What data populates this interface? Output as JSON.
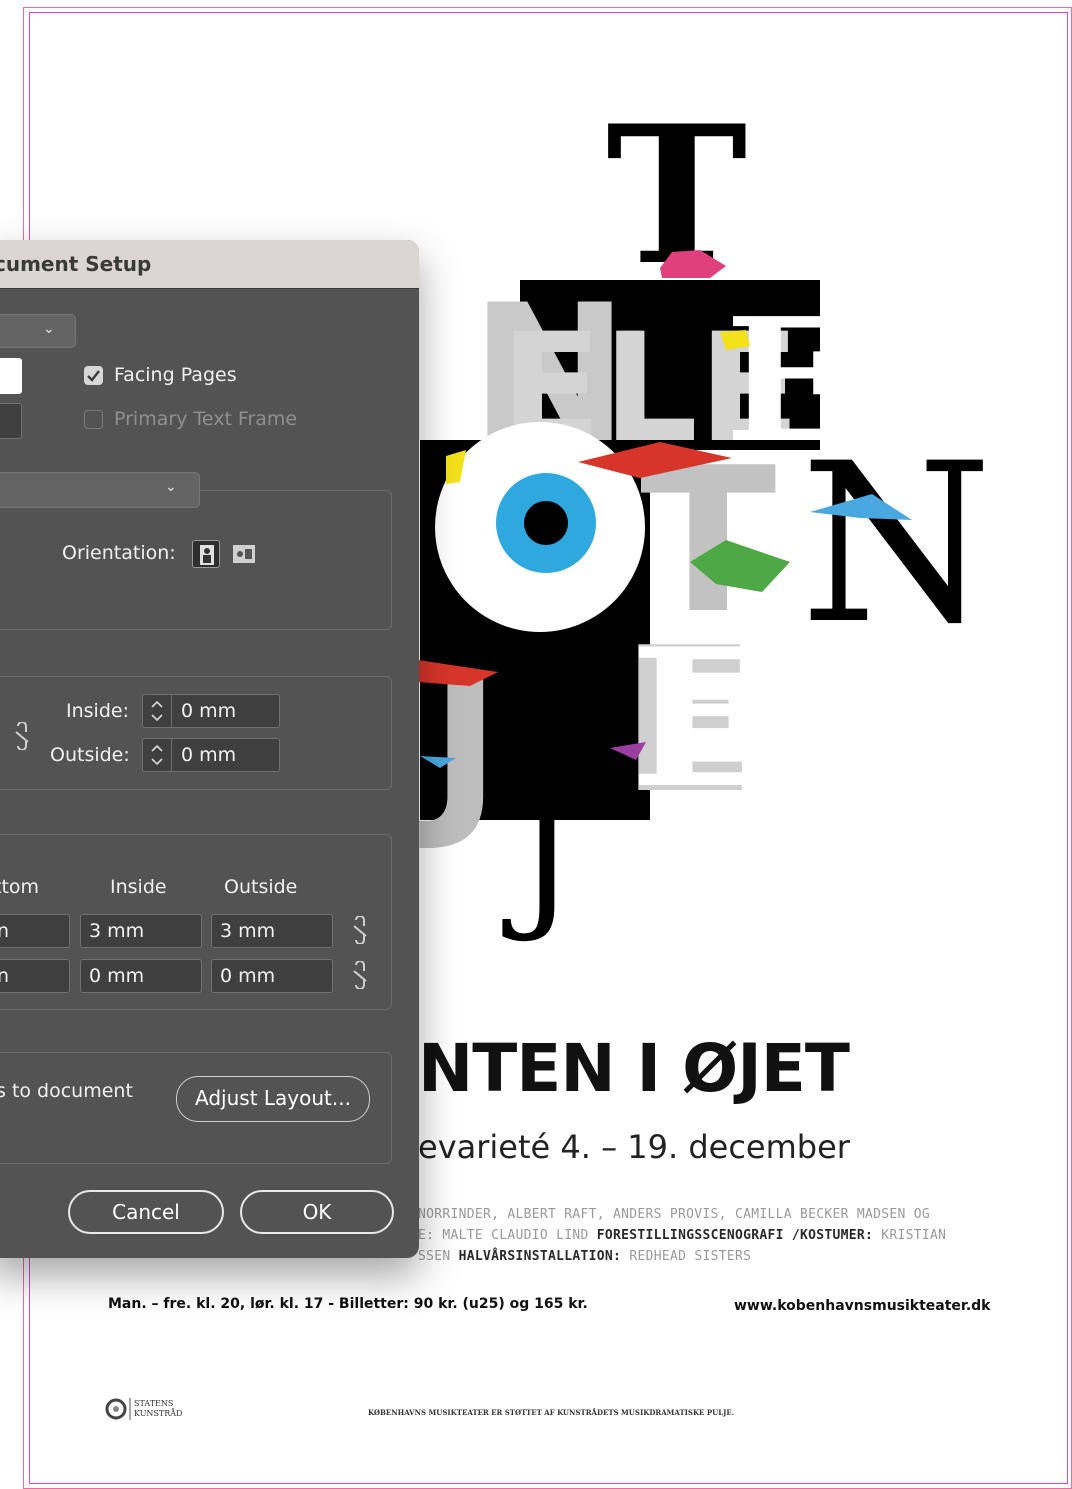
{
  "poster": {
    "title": "NTEN I ØJET",
    "subtitle": "evarieté 4. – 19. december",
    "credits_line1": "NORRINDER, ALBERT RAFT, ANDERS PROVIS, CAMILLA BECKER MADSEN OG",
    "credits_line2_a": "E: MALTE CLAUDIO LIND ",
    "credits_line2_b": "FORESTILLINGSSCENOGRAFI /KOSTUMER: ",
    "credits_line2_c": "KRISTIAN",
    "credits_line3_a": "SSEN ",
    "credits_line3_b": "HALVÅRSINSTALLATION: ",
    "credits_line3_c": "REDHEAD SISTERS",
    "info_left": "Man. – fre. kl. 20, lør. kl. 17 - Billetter: 90 kr. (u25) og 165 kr.",
    "info_right": "www.kobenhavnsmusikteater.dk",
    "sponsor_logo_text": "STATENS KUNSTRÅD",
    "sponsor_text": "KØBENHAVNS MUSIKTEATER ER STØTTET AF KUNSTRÅDETS MUSIKDRAMATISKE PULJE.",
    "letters": [
      "T",
      "N",
      "E",
      "L",
      "E",
      "Ø",
      "T",
      "N",
      "E",
      "T",
      "J"
    ]
  },
  "dialog": {
    "title": "cument Setup",
    "facing_pages_label": "Facing Pages",
    "facing_pages_checked": true,
    "primary_text_frame_label": "Primary Text Frame",
    "primary_text_frame_checked": false,
    "orientation_label": "Orientation:",
    "inside_label": "Inside:",
    "inside_value": "0 mm",
    "outside_label": "Outside:",
    "outside_value": "0 mm",
    "bleed_headers": {
      "bottom": "ttom",
      "inside": "Inside",
      "outside": "Outside"
    },
    "bleed_row": {
      "bottom": "n",
      "inside": "3 mm",
      "outside": "3 mm"
    },
    "slug_row": {
      "bottom": "n",
      "inside": "0 mm",
      "outside": "0 mm"
    },
    "adjust_text": "s to document",
    "adjust_layout_button": "Adjust Layout...",
    "cancel_button": "Cancel",
    "ok_button": "OK"
  },
  "colors": {
    "dialog_bg": "#535353",
    "accent_pink": "#e0407c",
    "accent_blue": "#2ea8df",
    "accent_red": "#d8352a",
    "accent_green": "#4ea845",
    "accent_yellow": "#f3e21a",
    "accent_purple": "#9a3ea0"
  }
}
